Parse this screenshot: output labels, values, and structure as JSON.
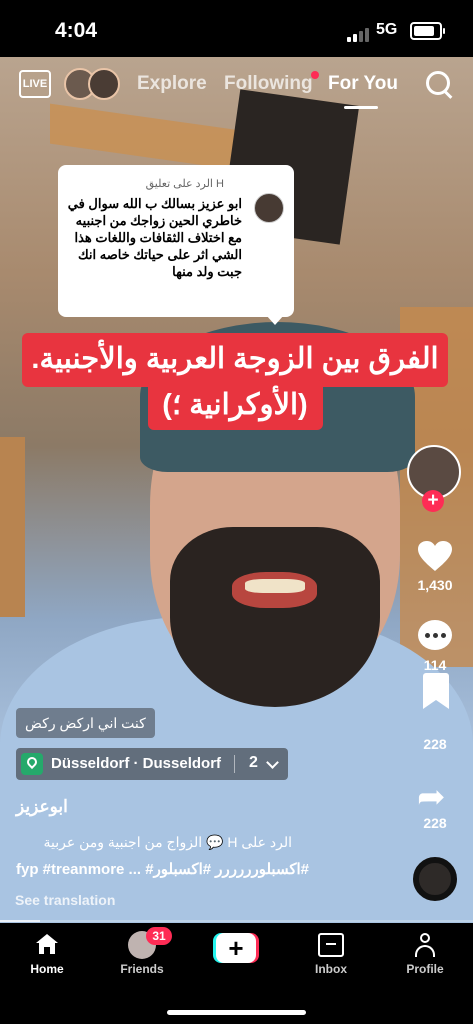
{
  "status_bar": {
    "time": "4:04",
    "network": "5G"
  },
  "top_nav": {
    "live_label": "LIVE",
    "tabs": [
      {
        "label": "Explore"
      },
      {
        "label": "Following"
      },
      {
        "label": "For You"
      }
    ]
  },
  "reply_card": {
    "header": "الرد على تعليق H",
    "text": "ابو عزيز بسالك ب الله سوال في خاطري الحين زواجك من اجنبيه مع اختلاف الثقافات واللغات هذا الشي اثر على حياتك خاصه انك جبت ولد منها"
  },
  "banner": {
    "line1": "الفرق بين الزوجة العربية والأجنبية.",
    "line2": "(الأوكرانية ؛)"
  },
  "actions": {
    "follow_label": "+",
    "likes": "1,430",
    "comments": "114",
    "saves": "228",
    "shares": "228"
  },
  "caption": {
    "chip": "كنت اني اركض ركض",
    "location": "Düsseldorf · Dusseldorf",
    "location_count": "2",
    "username": "ابوعزيز",
    "line1": "الرد على H 💬 الزواج من اجنبية ومن عربية",
    "line2": "fyp #treanmore ... #اكسبلورررررر #اكسبلور#",
    "see_translation": "See translation"
  },
  "bottom_nav": {
    "items": [
      {
        "label": "Home"
      },
      {
        "label": "Friends",
        "badge": "31"
      },
      {
        "label": "+"
      },
      {
        "label": "Inbox"
      },
      {
        "label": "Profile"
      }
    ]
  },
  "colors": {
    "accent": "#fe2c55",
    "banner": "#e8343f",
    "location": "#25a96b"
  }
}
